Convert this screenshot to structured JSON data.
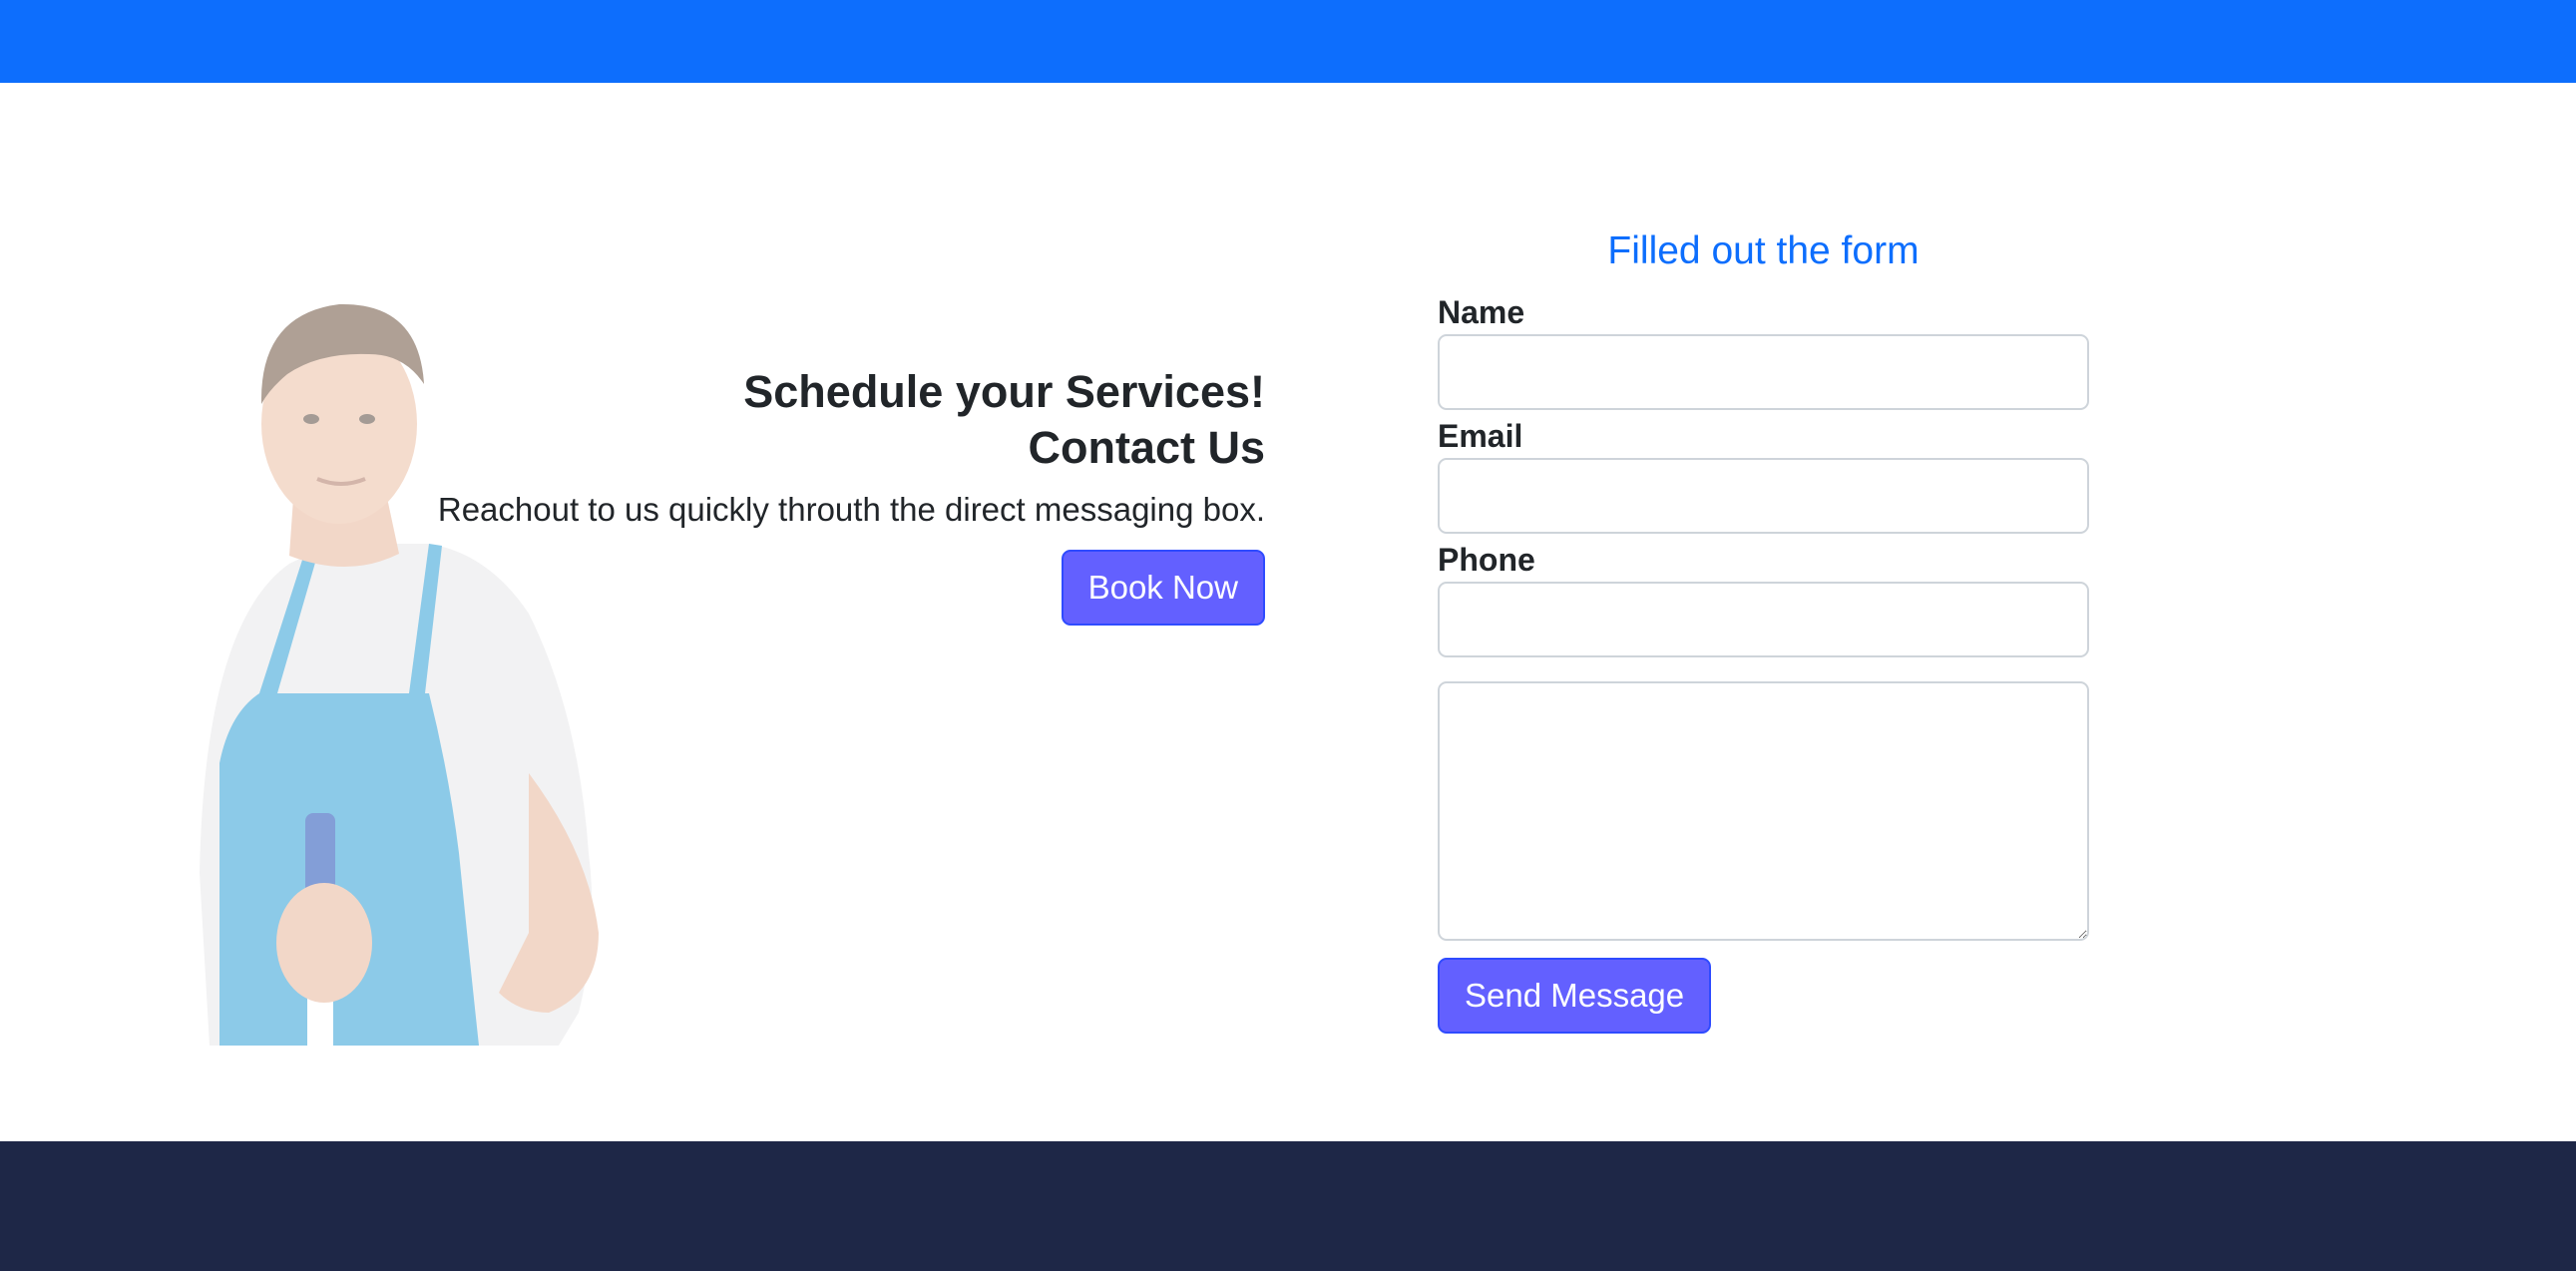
{
  "colors": {
    "topbar": "#0d6efd",
    "footer": "#1e2747",
    "button": "#6360ff",
    "form_title": "#0d6efd"
  },
  "hero": {
    "image": "cleaner-man-apron-photo",
    "title_line1": "Schedule your Services!",
    "title_line2": "Contact Us",
    "description": "Reachout to us quickly throuth the direct messaging box.",
    "book_button": "Book Now"
  },
  "form": {
    "title": "Filled out the form",
    "name_label": "Name",
    "name_value": "",
    "email_label": "Email",
    "email_value": "",
    "phone_label": "Phone",
    "phone_value": "",
    "message_value": "",
    "send_button": "Send Message"
  }
}
